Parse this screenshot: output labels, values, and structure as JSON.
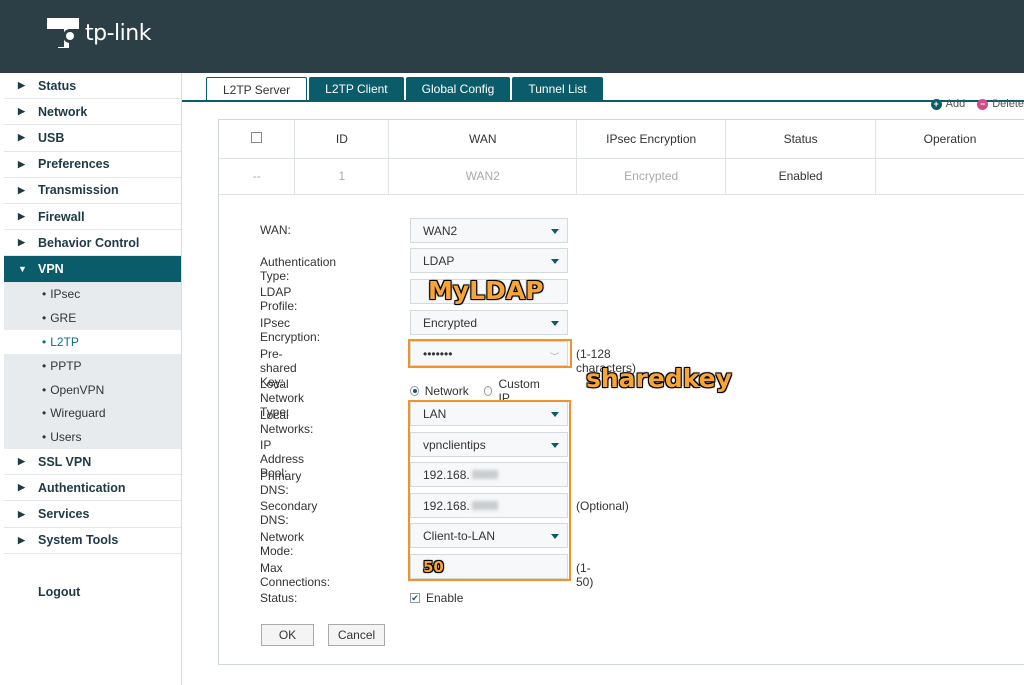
{
  "brand": {
    "logo_text": "tp-link"
  },
  "sidebar": {
    "items_before": [
      {
        "label": "Status"
      },
      {
        "label": "Network"
      },
      {
        "label": "USB"
      },
      {
        "label": "Preferences"
      },
      {
        "label": "Transmission"
      },
      {
        "label": "Firewall"
      },
      {
        "label": "Behavior Control"
      }
    ],
    "vpn": {
      "label": "VPN",
      "sub": [
        "IPsec",
        "GRE",
        "L2TP",
        "PPTP",
        "OpenVPN",
        "Wireguard",
        "Users"
      ]
    },
    "items_after": [
      {
        "label": "SSL VPN"
      },
      {
        "label": "Authentication"
      },
      {
        "label": "Services"
      },
      {
        "label": "System Tools"
      }
    ],
    "logout": "Logout"
  },
  "tabs": [
    "L2TP Server",
    "L2TP Client",
    "Global Config",
    "Tunnel List"
  ],
  "toolbar": {
    "add": "Add",
    "delete": "Delete"
  },
  "table": {
    "headers": [
      "ID",
      "WAN",
      "IPsec Encryption",
      "Status",
      "Operation"
    ],
    "row": {
      "check": "--",
      "id": "1",
      "wan": "WAN2",
      "ipsec": "Encrypted",
      "status": "Enabled",
      "operation": ""
    }
  },
  "form": {
    "wan_label": "WAN:",
    "wan_value": "WAN2",
    "auth_label": "Authentication Type:",
    "auth_value": "LDAP",
    "ldap_label": "LDAP Profile:",
    "ldap_value": "",
    "ipsec_label": "IPsec Encryption:",
    "ipsec_value": "Encrypted",
    "psk_label": "Pre-shared Key:",
    "psk_value": "•••••••",
    "psk_hint": "(1-128 characters)",
    "lnt_label": "Local Network Type:",
    "lnt_network": "Network",
    "lnt_custom": "Custom IP",
    "ln_label": "Local Networks:",
    "ln_value": "LAN",
    "pool_label": "IP Address Pool:",
    "pool_value": "vpnclientips",
    "pdns_label": "Primary DNS:",
    "pdns_value": "192.168.",
    "sdns_label": "Secondary DNS:",
    "sdns_value": "192.168.",
    "sdns_hint": "(Optional)",
    "mode_label": "Network Mode:",
    "mode_value": "Client-to-LAN",
    "max_label": "Max Connections:",
    "max_hint": "(1-50)",
    "status_label": "Status:",
    "status_value": "Enable",
    "ok": "OK",
    "cancel": "Cancel"
  },
  "annotations": {
    "ldap": "MyLDAP",
    "psk": "sharedkey",
    "max": "50"
  },
  "colors": {
    "header": "#2d3f46",
    "accent": "#0b5c6b",
    "highlight": "#f0932b",
    "annotation": "#f7a534"
  }
}
